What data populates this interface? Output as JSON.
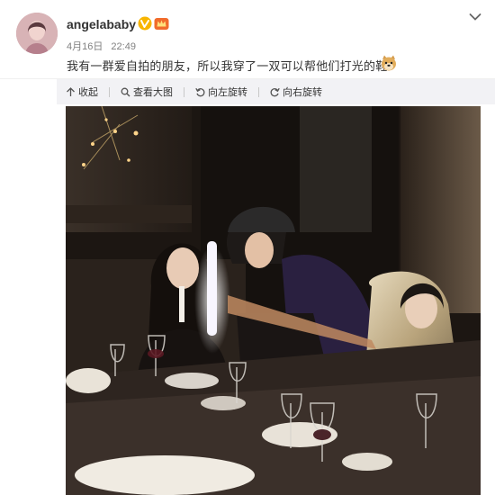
{
  "post": {
    "username": "angelababy",
    "date": "4月16日",
    "time": "22:49",
    "text": "我有一群爱自拍的朋友，所以我穿了一双可以帮他们打光的鞋",
    "icons": {
      "verified": "verified-v-icon",
      "vip": "vip-crown-icon",
      "emoji": "doge-emoji-icon",
      "more": "chevron-down-icon"
    }
  },
  "toolbar": {
    "collapse_label": "收起",
    "view_large_label": "查看大图",
    "rotate_left_label": "向左旋转",
    "rotate_right_label": "向右旋转"
  },
  "colors": {
    "username": "#333333",
    "meta": "#808080",
    "verified_bg": "#f8b500",
    "vip_bg": "#f16b2b",
    "toolbar_bg": "#f2f2f5"
  }
}
